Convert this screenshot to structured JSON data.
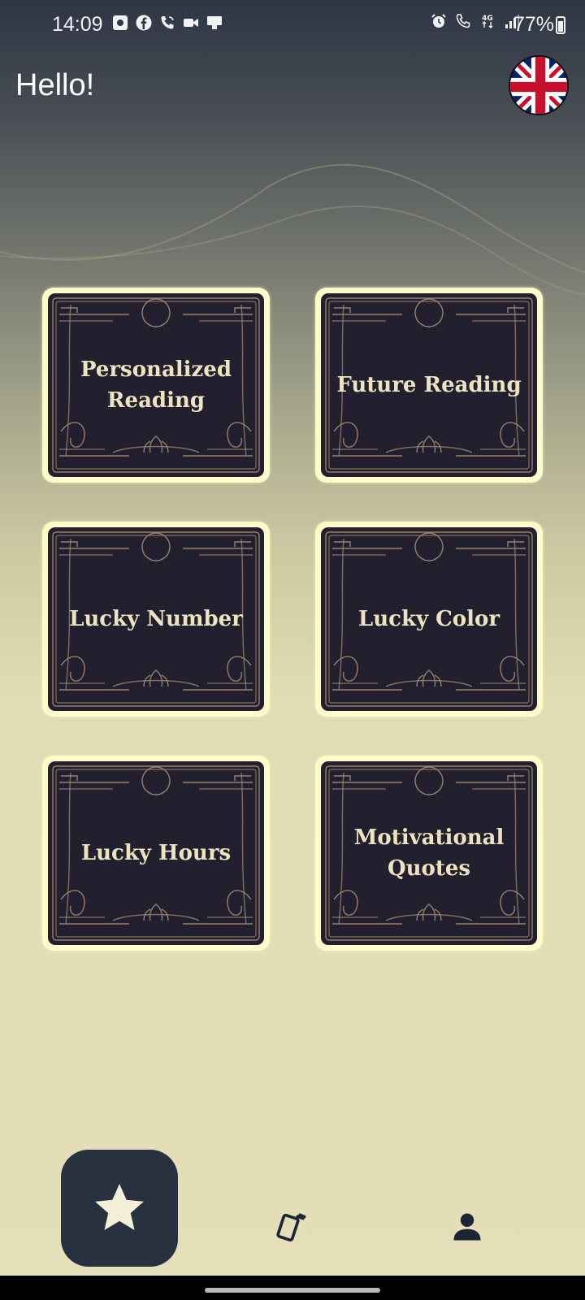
{
  "status_bar": {
    "time": "14:09",
    "battery": "77%",
    "left_icons": [
      "camera-app-icon",
      "facebook-icon",
      "wifi-call-icon",
      "video-call-icon",
      "screen-cast-icon"
    ],
    "right_icons": [
      "alarm-icon",
      "volte-call-icon",
      "4g-icon",
      "signal-icon",
      "battery-icon"
    ],
    "network": "4G"
  },
  "header": {
    "greeting": "Hello!",
    "language_flag": "uk-flag-icon"
  },
  "cards": [
    {
      "label": "Personalized Reading"
    },
    {
      "label": "Future Reading"
    },
    {
      "label": "Lucky Number"
    },
    {
      "label": "Lucky Color"
    },
    {
      "label": "Lucky Hours"
    },
    {
      "label": "Motivational Quotes"
    }
  ],
  "bottom_nav": {
    "items": [
      {
        "icon": "star-icon",
        "active": true
      },
      {
        "icon": "cards-icon",
        "active": false
      },
      {
        "icon": "profile-icon",
        "active": false
      }
    ]
  },
  "colors": {
    "card_background": "#22202e",
    "card_border": "#fefccb",
    "card_text": "#eee3bf",
    "nav_active": "#283140",
    "page_bottom": "#e4dfb8"
  }
}
